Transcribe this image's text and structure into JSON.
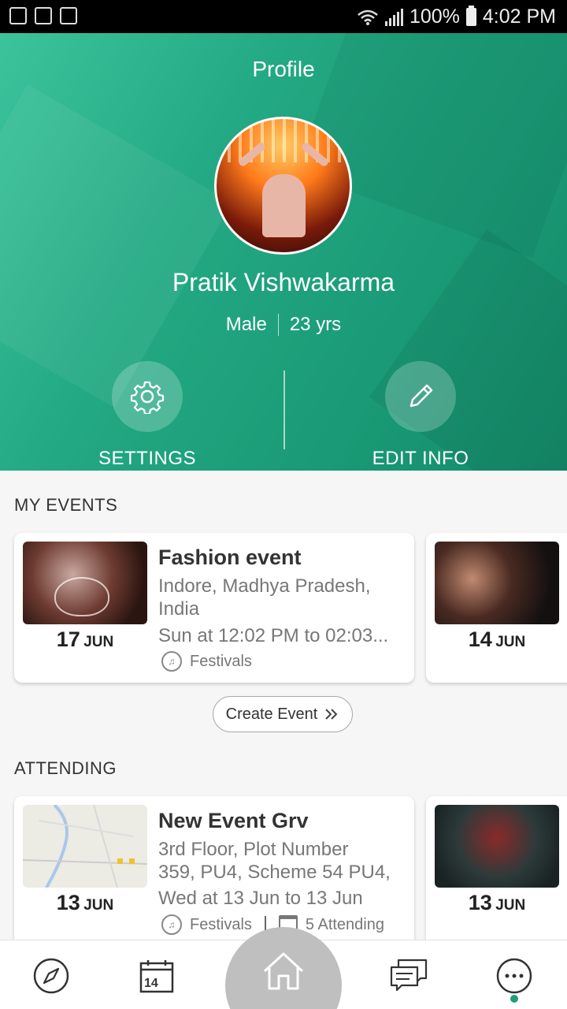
{
  "status_bar": {
    "battery": "100%",
    "time": "4:02 PM"
  },
  "header": {
    "title": "Profile",
    "name": "Pratik Vishwakarma",
    "gender": "Male",
    "age": "23 yrs",
    "settings_label": "SETTINGS",
    "edit_label": "EDIT INFO"
  },
  "my_events": {
    "title": "MY EVENTS",
    "items": [
      {
        "day": "17",
        "month": "JUN",
        "title": "Fashion event",
        "location_line1": "Indore, Madhya Pradesh,",
        "location_line2": "India",
        "time": "Sun at 12:02 PM to 02:03...",
        "category": "Festivals"
      },
      {
        "day": "14",
        "month": "JUN"
      }
    ],
    "create_label": "Create Event"
  },
  "attending": {
    "title": "ATTENDING",
    "items": [
      {
        "day": "13",
        "month": "JUN",
        "title": "New Event Grv",
        "location_line1": "3rd Floor, Plot Number",
        "location_line2": "359, PU4, Scheme 54 PU4,",
        "time": "Wed at 13 Jun to 13 Jun",
        "category": "Festivals",
        "attending": "5 Attending"
      },
      {
        "day": "13",
        "month": "JUN"
      }
    ]
  },
  "bottom_nav": {
    "items": [
      "explore-icon",
      "calendar-icon",
      "home-icon",
      "chat-icon",
      "more-icon"
    ],
    "active": "more-icon",
    "calendar_badge": "14"
  },
  "colors": {
    "header_green": "#1e9e7a",
    "nav_dot": "#1e9e7a",
    "home_circle": "#bfbfbf"
  }
}
